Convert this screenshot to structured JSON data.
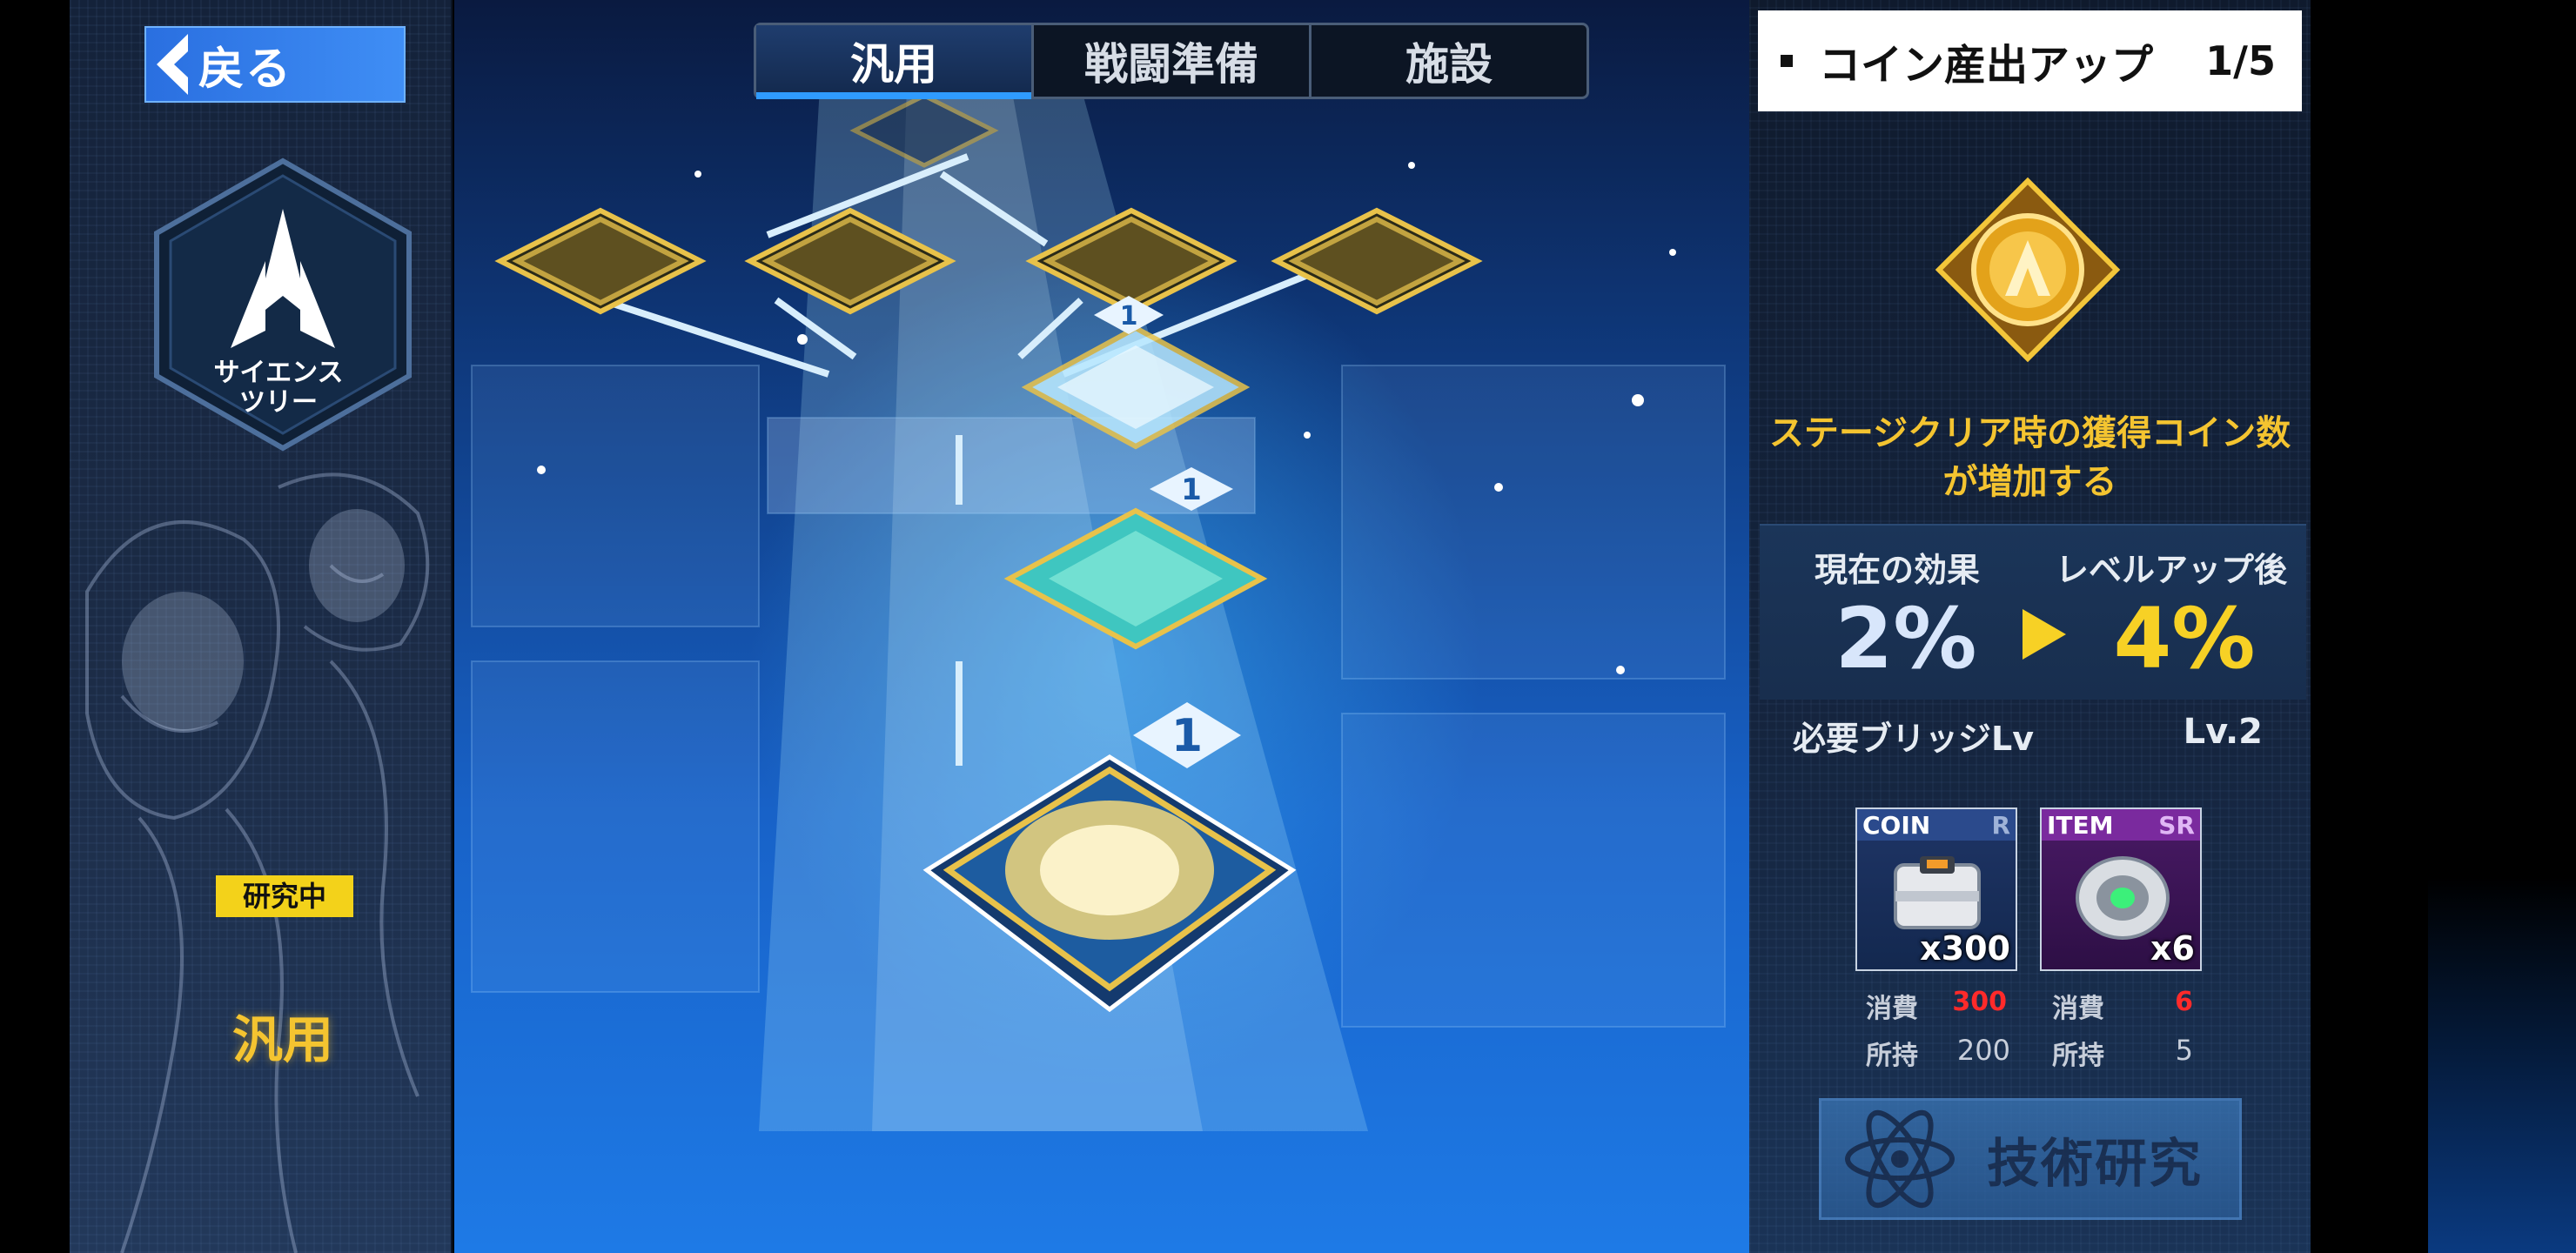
{
  "nav": {
    "back_label": "戻る"
  },
  "tabs": [
    {
      "label": "汎用",
      "active": true
    },
    {
      "label": "戦闘準備",
      "active": false
    },
    {
      "label": "施設",
      "active": false
    }
  ],
  "left_panel": {
    "tree_label_line1": "サイエンス",
    "tree_label_line2": "ツリー",
    "status_badge": "研究中",
    "category": "汎用"
  },
  "tree": {
    "connector_labels": [
      "1",
      "1",
      "1"
    ]
  },
  "skill": {
    "name": "コイン産出アップ",
    "level": "1/5",
    "description_line1": "ステージクリア時の獲得コイン数",
    "description_line2": "が増加する",
    "current_effect_label": "現在の効果",
    "current_effect_value": "2%",
    "after_levelup_label": "レベルアップ後",
    "after_levelup_value": "4%",
    "required_label": "必要ブリッジLv",
    "required_value": "Lv.2"
  },
  "costs": [
    {
      "type": "COIN",
      "rarity": "R",
      "qty": "x300",
      "consume_label": "消費",
      "consume_value": "300",
      "owned_label": "所持",
      "owned_value": "200"
    },
    {
      "type": "ITEM",
      "rarity": "SR",
      "qty": "x6",
      "consume_label": "消費",
      "consume_value": "6",
      "owned_label": "所持",
      "owned_value": "5"
    }
  ],
  "research_button": {
    "label": "技術研究"
  },
  "colors": {
    "accent_gold": "#f4c430",
    "accent_blue": "#2f9bff",
    "cost_red": "#ff2a2a"
  }
}
